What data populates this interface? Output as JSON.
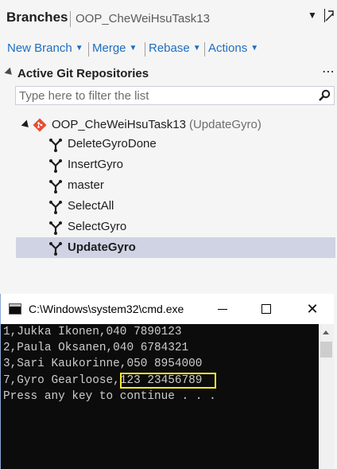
{
  "header": {
    "title": "Branches",
    "subtitle": "OOP_CheWeiHsuTask13",
    "dropdown_icon": "caret-down-icon",
    "pin_icon": "pin-icon"
  },
  "actions": [
    {
      "label": "New Branch"
    },
    {
      "label": "Merge"
    },
    {
      "label": "Rebase"
    },
    {
      "label": "Actions"
    }
  ],
  "section": {
    "title": "Active Git Repositories",
    "more": "⋯"
  },
  "filter": {
    "placeholder": "Type here to filter the list",
    "value": ""
  },
  "repo": {
    "name": "OOP_CheWeiHsuTask13",
    "current_branch": "(UpdateGyro)"
  },
  "branches": [
    {
      "label": "DeleteGyroDone",
      "active": false
    },
    {
      "label": "InsertGyro",
      "active": false
    },
    {
      "label": "master",
      "active": false
    },
    {
      "label": "SelectAll",
      "active": false
    },
    {
      "label": "SelectGyro",
      "active": false
    },
    {
      "label": "UpdateGyro",
      "active": true
    }
  ],
  "cmd": {
    "title": "C:\\Windows\\system32\\cmd.exe",
    "lines": [
      "1,Jukka Ikonen,040 7890123",
      "2,Paula Oksanen,040 6784321",
      "3,Sari Kaukorinne,050 8954000",
      "7,Gyro Gearloose,123 23456789",
      "Press any key to continue . . ."
    ],
    "highlight_color": "#f7e92a"
  },
  "colors": {
    "link": "#1e6ec0",
    "selected_row": "#cfd3e3",
    "console_bg": "#0c0c0c",
    "console_fg": "#cccccc"
  }
}
